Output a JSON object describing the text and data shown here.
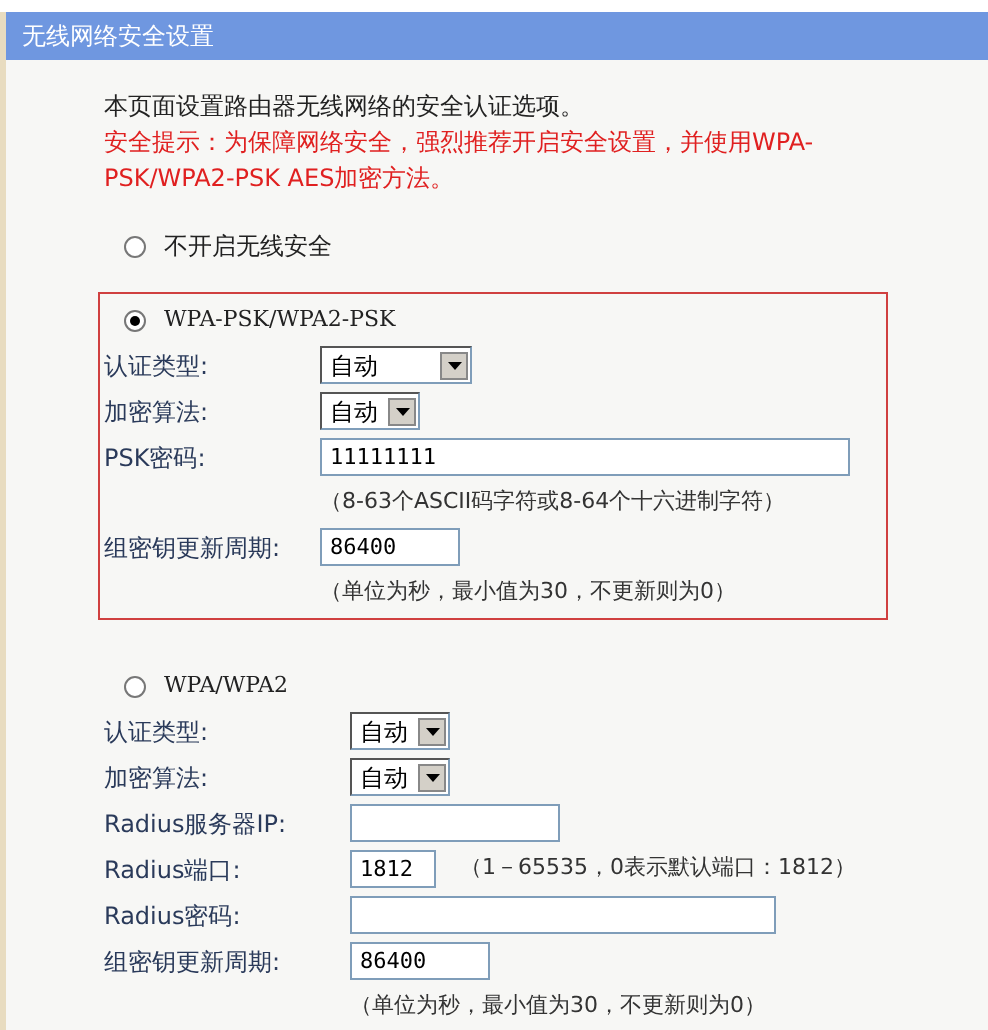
{
  "window": {
    "title": "无线网络安全设置"
  },
  "intro": "本页面设置路由器无线网络的安全认证选项。",
  "warning": "安全提示：为保障网络安全，强烈推荐开启安全设置，并使用WPA-PSK/WPA2-PSK AES加密方法。",
  "options": [
    {
      "label": "不开启无线安全",
      "selected": false
    },
    {
      "label": "WPA-PSK/WPA2-PSK",
      "selected": true,
      "rows": [
        {
          "kind": "select-wide",
          "label": "认证类型:",
          "value": "自动"
        },
        {
          "kind": "select",
          "label": "加密算法:",
          "value": "自动"
        },
        {
          "kind": "field-long",
          "label": "PSK密码:",
          "value": "11111111"
        },
        {
          "kind": "note",
          "text": "（8-63个ASCII码字符或8-64个十六进制字符）"
        },
        {
          "kind": "field-short",
          "label": "组密钥更新周期:",
          "value": "86400"
        },
        {
          "kind": "note",
          "text": "（单位为秒，最小值为30，不更新则为0）"
        }
      ]
    },
    {
      "label": "WPA/WPA2",
      "selected": false,
      "rows": [
        {
          "kind": "select",
          "label": "认证类型:",
          "value": "自动"
        },
        {
          "kind": "select",
          "label": "加密算法:",
          "value": "自动"
        },
        {
          "kind": "field-medium",
          "label": "Radius服务器IP:",
          "value": ""
        },
        {
          "kind": "field-tiny",
          "label": "Radius端口:",
          "value": "1812",
          "hint": "（1－65535，0表示默认端口：1812）"
        },
        {
          "kind": "field-mid-long",
          "label": "Radius密码:",
          "value": ""
        },
        {
          "kind": "field-short",
          "label": "组密钥更新周期:",
          "value": "86400"
        },
        {
          "kind": "note",
          "text": "（单位为秒，最小值为30，不更新则为0）"
        }
      ]
    }
  ]
}
